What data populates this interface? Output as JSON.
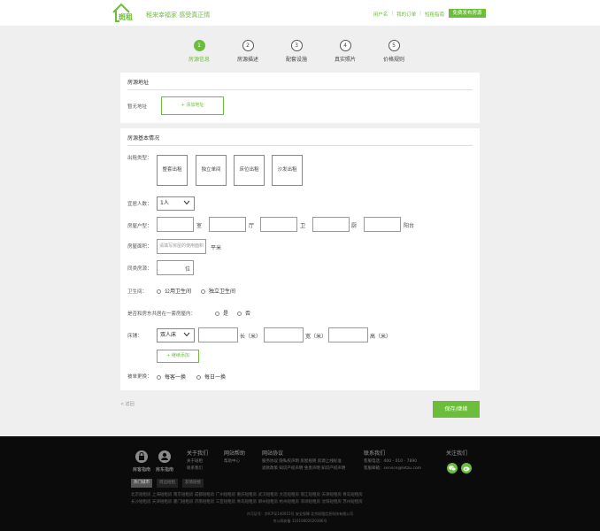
{
  "header": {
    "logo_text": "斑租",
    "slogan": "租来幸福家  感受真正情",
    "links": [
      "用户名",
      "我的订单",
      "短租指南"
    ],
    "publish_button": "免费发布房源"
  },
  "steps": [
    {
      "num": "1",
      "label": "房源信息",
      "active": true
    },
    {
      "num": "2",
      "label": "房源描述",
      "active": false
    },
    {
      "num": "3",
      "label": "配套设施",
      "active": false
    },
    {
      "num": "4",
      "label": "真实照片",
      "active": false
    },
    {
      "num": "5",
      "label": "价格规则",
      "active": false
    }
  ],
  "address_card": {
    "title": "房源地址",
    "none_label": "暂无地址",
    "add_button": "+ 添加地址"
  },
  "basic_card": {
    "title": "房源基本情况",
    "rent_type_label": "出租类型：",
    "rent_types": [
      "整套出租",
      "独立单间",
      "床位出租",
      "沙发出租"
    ],
    "occupancy_label": "宜居人数：",
    "occupancy_value": "1人",
    "layout_label": "房屋户型：",
    "layout_units": [
      "室",
      "厅",
      "卫",
      "厨",
      "阳台"
    ],
    "area_label": "房屋面积：",
    "area_placeholder": "请填写房屋的使用面积",
    "area_unit": "平米",
    "same_type_label": "同类房源：",
    "same_type_unit": "位",
    "bathroom_label": "卫生间：",
    "bathroom_options": [
      "公用卫生间",
      "独立卫生间"
    ],
    "share_label": "是否和房东共居在一套房屋内：",
    "share_options": [
      "是",
      "否"
    ],
    "bed_label": "床铺：",
    "bed_type": "双人床",
    "bed_units": [
      "长（米）",
      "宽（米）",
      "高（米）"
    ],
    "add_bed_button": "+ 继续添加",
    "linen_label": "被单更换：",
    "linen_options": [
      "每客一换",
      "每日一换"
    ]
  },
  "actions": {
    "back": "< 返回",
    "save": "保存/继续"
  },
  "footer": {
    "icons": [
      {
        "label": "房客指南"
      },
      {
        "label": "房东指南"
      }
    ],
    "columns": [
      {
        "title": "关于我们",
        "items": [
          "关于斑租",
          "联系我们"
        ]
      },
      {
        "title": "网站帮助",
        "items": [
          "帮助中心"
        ]
      },
      {
        "title": "网站协议",
        "items": [
          "服务协议  隐私权声明  房屋规则  房源上线标准",
          "退款政策  知识产权声明  免责声明  知识产权声明"
        ]
      },
      {
        "title": "联系我们",
        "items": [
          "客服电话：400 - 010 - 7890",
          "客服邮箱：service@letzu.com"
        ]
      },
      {
        "title": "关注我们",
        "items": []
      }
    ],
    "tabs": [
      "热门城市",
      "周边短租",
      "友情链接"
    ],
    "cities_line1": "北京短租房  上海短租房  南京短租房  成都短租房  广州短租房  重庆短租房  武汉短租房  大连短租房  丽江短租房  天津短租房  青岛短租房",
    "cities_line2": "长沙短租房  天津短租房  厦门短租房  济南短租房  三亚短租房  青岛短租房  郑州短租房  杭州短租房  深圳短租房  沈阳短租房  苏州短租房",
    "copy_line1": "许可证号：京ICP证140015号   安全保障   北京斑租信息科技有限公司",
    "copy_line2": "京公网安备 11010802020386号"
  }
}
